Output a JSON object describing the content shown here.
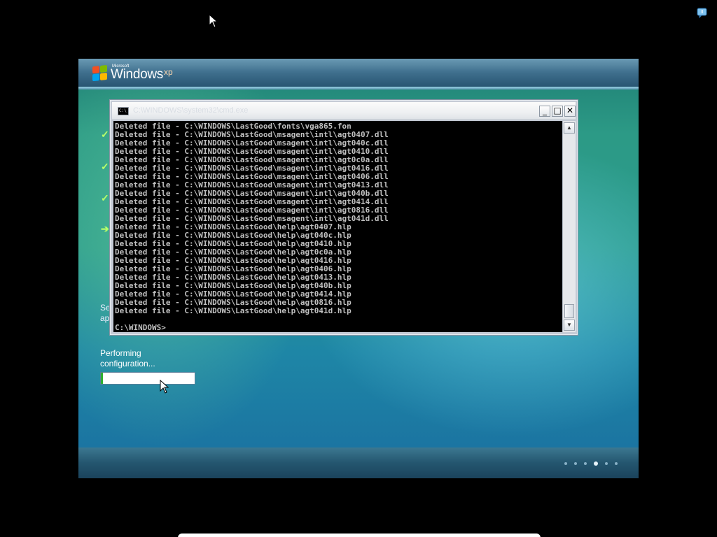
{
  "setup": {
    "logo_ms": "Microsoft",
    "logo_windows": "Windows",
    "logo_xp": "xp",
    "side_text_1": "Set",
    "side_text_2": "ap",
    "progress_label": "Performing configuration...",
    "progress_value": 0.02
  },
  "console": {
    "title": "C:\\WINDOWS\\system32\\cmd.exe",
    "lines": [
      "Deleted file - C:\\WINDOWS\\LastGood\\fonts\\vga865.fon",
      "Deleted file - C:\\WINDOWS\\LastGood\\msagent\\intl\\agt0407.dll",
      "Deleted file - C:\\WINDOWS\\LastGood\\msagent\\intl\\agt040c.dll",
      "Deleted file - C:\\WINDOWS\\LastGood\\msagent\\intl\\agt0410.dll",
      "Deleted file - C:\\WINDOWS\\LastGood\\msagent\\intl\\agt0c0a.dll",
      "Deleted file - C:\\WINDOWS\\LastGood\\msagent\\intl\\agt0416.dll",
      "Deleted file - C:\\WINDOWS\\LastGood\\msagent\\intl\\agt0406.dll",
      "Deleted file - C:\\WINDOWS\\LastGood\\msagent\\intl\\agt0413.dll",
      "Deleted file - C:\\WINDOWS\\LastGood\\msagent\\intl\\agt040b.dll",
      "Deleted file - C:\\WINDOWS\\LastGood\\msagent\\intl\\agt0414.dll",
      "Deleted file - C:\\WINDOWS\\LastGood\\msagent\\intl\\agt0816.dll",
      "Deleted file - C:\\WINDOWS\\LastGood\\msagent\\intl\\agt041d.dll",
      "Deleted file - C:\\WINDOWS\\LastGood\\help\\agt0407.hlp",
      "Deleted file - C:\\WINDOWS\\LastGood\\help\\agt040c.hlp",
      "Deleted file - C:\\WINDOWS\\LastGood\\help\\agt0410.hlp",
      "Deleted file - C:\\WINDOWS\\LastGood\\help\\agt0c0a.hlp",
      "Deleted file - C:\\WINDOWS\\LastGood\\help\\agt0416.hlp",
      "Deleted file - C:\\WINDOWS\\LastGood\\help\\agt0406.hlp",
      "Deleted file - C:\\WINDOWS\\LastGood\\help\\agt0413.hlp",
      "Deleted file - C:\\WINDOWS\\LastGood\\help\\agt040b.hlp",
      "Deleted file - C:\\WINDOWS\\LastGood\\help\\agt0414.hlp",
      "Deleted file - C:\\WINDOWS\\LastGood\\help\\agt0816.hlp",
      "Deleted file - C:\\WINDOWS\\LastGood\\help\\agt041d.hlp"
    ],
    "prompt": "C:\\WINDOWS>",
    "buttons": {
      "minimize": "_",
      "maximize": "□",
      "close": "✕"
    },
    "icon_label": "C:\\"
  },
  "icons": {
    "cursor": "arrow-cursor-icon",
    "tray": "notification-balloon-icon"
  },
  "colors": {
    "console_bg": "#000000",
    "console_text": "#c0c0c0",
    "step_check": "#b8ff6a",
    "progress_fill": "#2fb02f"
  }
}
